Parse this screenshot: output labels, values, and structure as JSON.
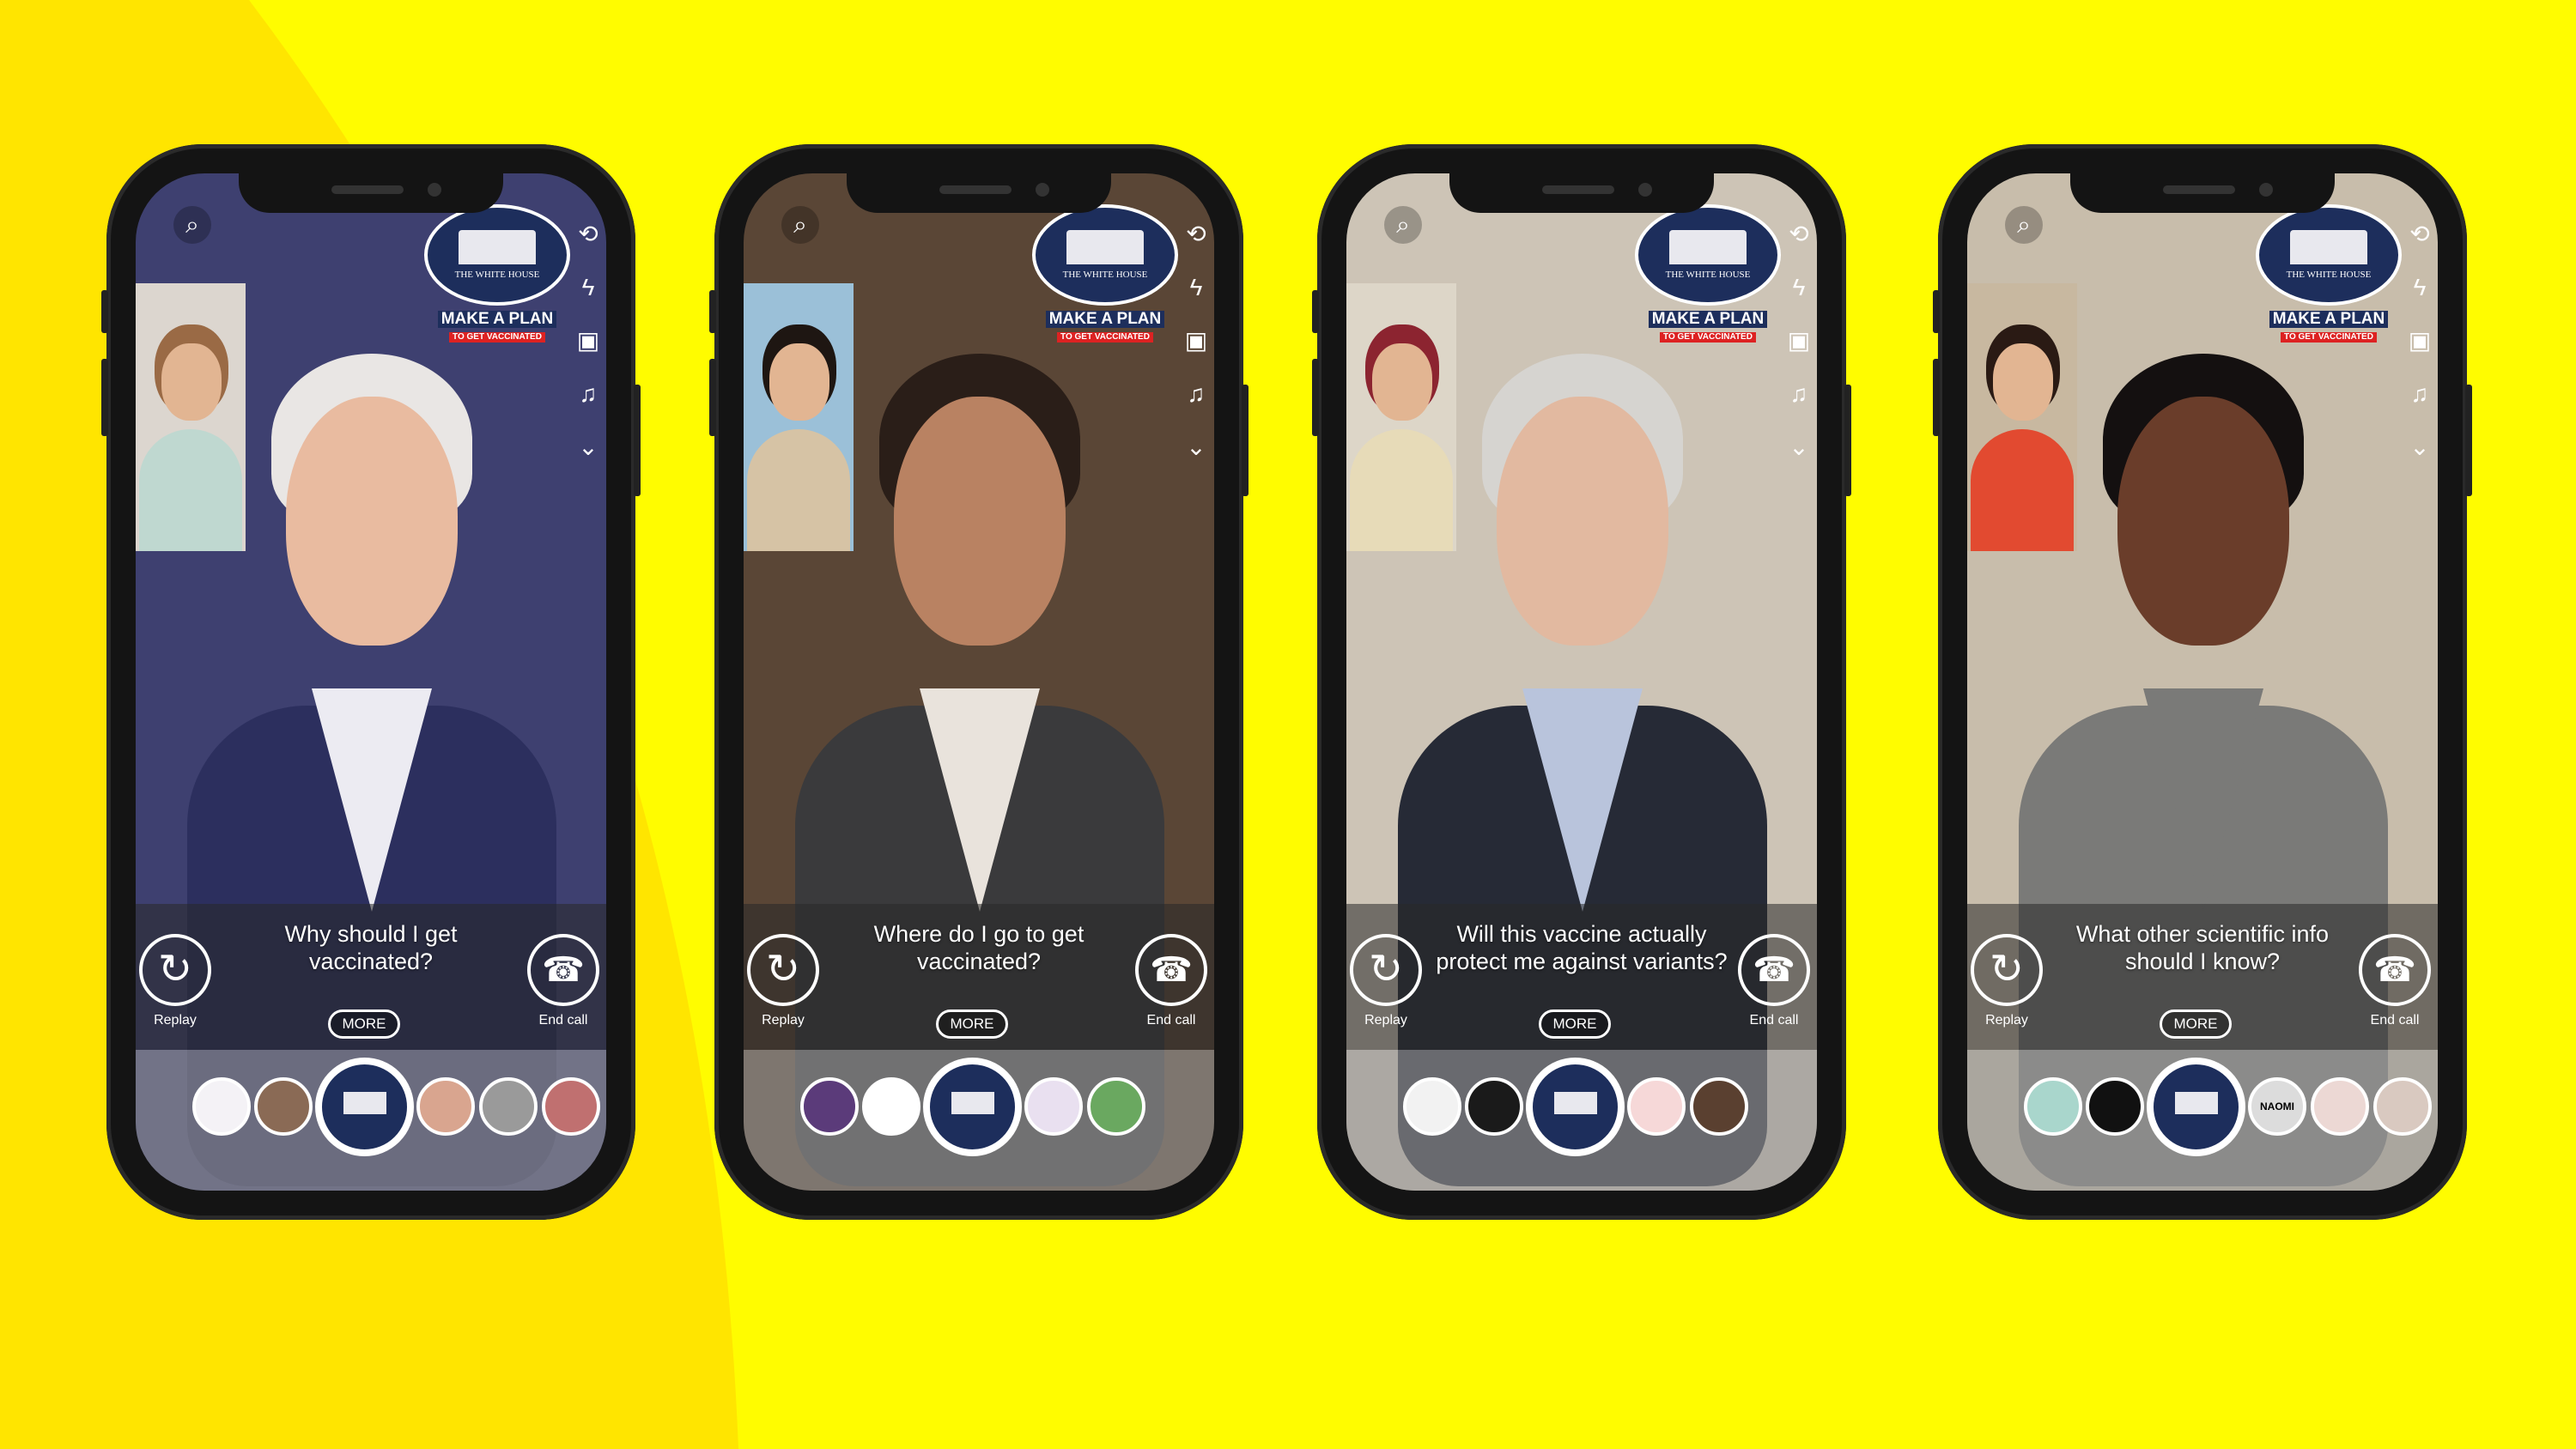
{
  "colors": {
    "background": "#FFFC00",
    "curve": "#FFE500",
    "logo_navy": "#1d2e5c",
    "plan_red": "#dd2222"
  },
  "common": {
    "logo_caption": "THE WHITE HOUSE",
    "plan_line1": "MAKE A PLAN",
    "plan_line2": "TO GET VACCINATED",
    "replay_label": "Replay",
    "end_call_label": "End call",
    "more_label": "MORE",
    "search_icon": "search-icon",
    "right_icons": [
      "flip-camera-icon",
      "flash-icon",
      "video-icon",
      "music-icon",
      "chevron-down-icon"
    ]
  },
  "phones": [
    {
      "question": "Why should I get vaccinated?",
      "wall": "#3e4070",
      "skin": "#e9bba0",
      "hair": "#e9e6e4",
      "suit": "#2c2f5e",
      "shirt": "#ecebf2",
      "pip_bg": "#dcd6cf",
      "pip_body": "#bfd8d0",
      "pip_hair": "#9a6a45",
      "lenses": [
        "#f4f2f6",
        "#8a6a55",
        "center",
        "#d9a58f",
        "#9a9a9a",
        "#c07070"
      ]
    },
    {
      "question": "Where do I go to get vaccinated?",
      "wall": "#5a4636",
      "skin": "#b98262",
      "hair": "#2a1e18",
      "suit": "#3a3a3c",
      "shirt": "#e9e3dc",
      "pip_bg": "#9bc0d8",
      "pip_body": "#d6c3a5",
      "pip_hair": "#1e1612",
      "lenses": [
        "#5b3b7a",
        "#ffffff",
        "center",
        "#e9e0f0",
        "#6aa860"
      ]
    },
    {
      "question": "Will this vaccine actually protect me against variants?",
      "wall": "#cdc4b6",
      "skin": "#e2b9a0",
      "hair": "#d6d4d0",
      "suit": "#262a36",
      "shirt": "#b9c4dc",
      "pip_bg": "#ddd6c8",
      "pip_body": "#e7dbb8",
      "pip_hair": "#8c2430",
      "lenses": [
        "#f2f2f2",
        "#1a1a1a",
        "center",
        "#f6d8d8",
        "#5a4030"
      ]
    },
    {
      "question": "What other scientific info should I know?",
      "wall": "#c8bdab",
      "skin": "#6a3d2a",
      "hair": "#141010",
      "suit": "#7a7a78",
      "shirt": "#7a7a78",
      "pip_bg": "#c8b8a0",
      "pip_body": "#e24a30",
      "pip_hair": "#2a1a14",
      "lenses": [
        "#a9d6cc",
        "#111111",
        "center",
        "#dcdcdc",
        "#ecd8d4",
        "#d9c9c0"
      ],
      "lens_text": {
        "3": "NAOMI"
      }
    }
  ]
}
